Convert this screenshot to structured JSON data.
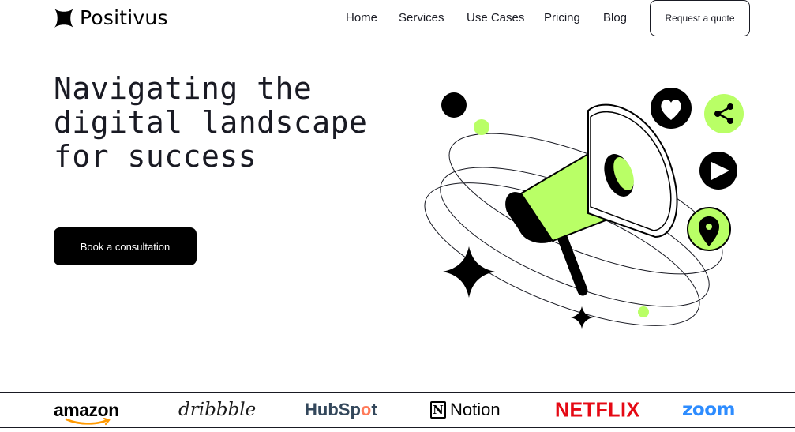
{
  "header": {
    "brand_name": "Positivus",
    "nav": [
      {
        "label": "Home"
      },
      {
        "label": "Services"
      },
      {
        "label": "Use Cases"
      },
      {
        "label": "Pricing"
      },
      {
        "label": "Blog"
      }
    ],
    "cta_label": "Request a quote"
  },
  "hero": {
    "title_lines": [
      "Navigating the",
      "digital landscape",
      "for success"
    ],
    "cta_label": "Book a consultation"
  },
  "logos": {
    "amazon": "amazon",
    "dribbble": "dribbble",
    "hubspot_pre": "HubSp",
    "hubspot_o": "o",
    "hubspot_post": "t",
    "notion_mark": "N",
    "notion": "Notion",
    "netflix": "NETFLIX",
    "zoom": "zoom"
  },
  "colors": {
    "accent_green": "#b9ff66",
    "dark": "#191a23",
    "black": "#000000"
  },
  "icons": {
    "brand": "four-point-star-icon",
    "illustration": "megaphone-icon",
    "bubbles": [
      "heart-icon",
      "share-icon",
      "play-icon",
      "location-pin-icon"
    ]
  }
}
